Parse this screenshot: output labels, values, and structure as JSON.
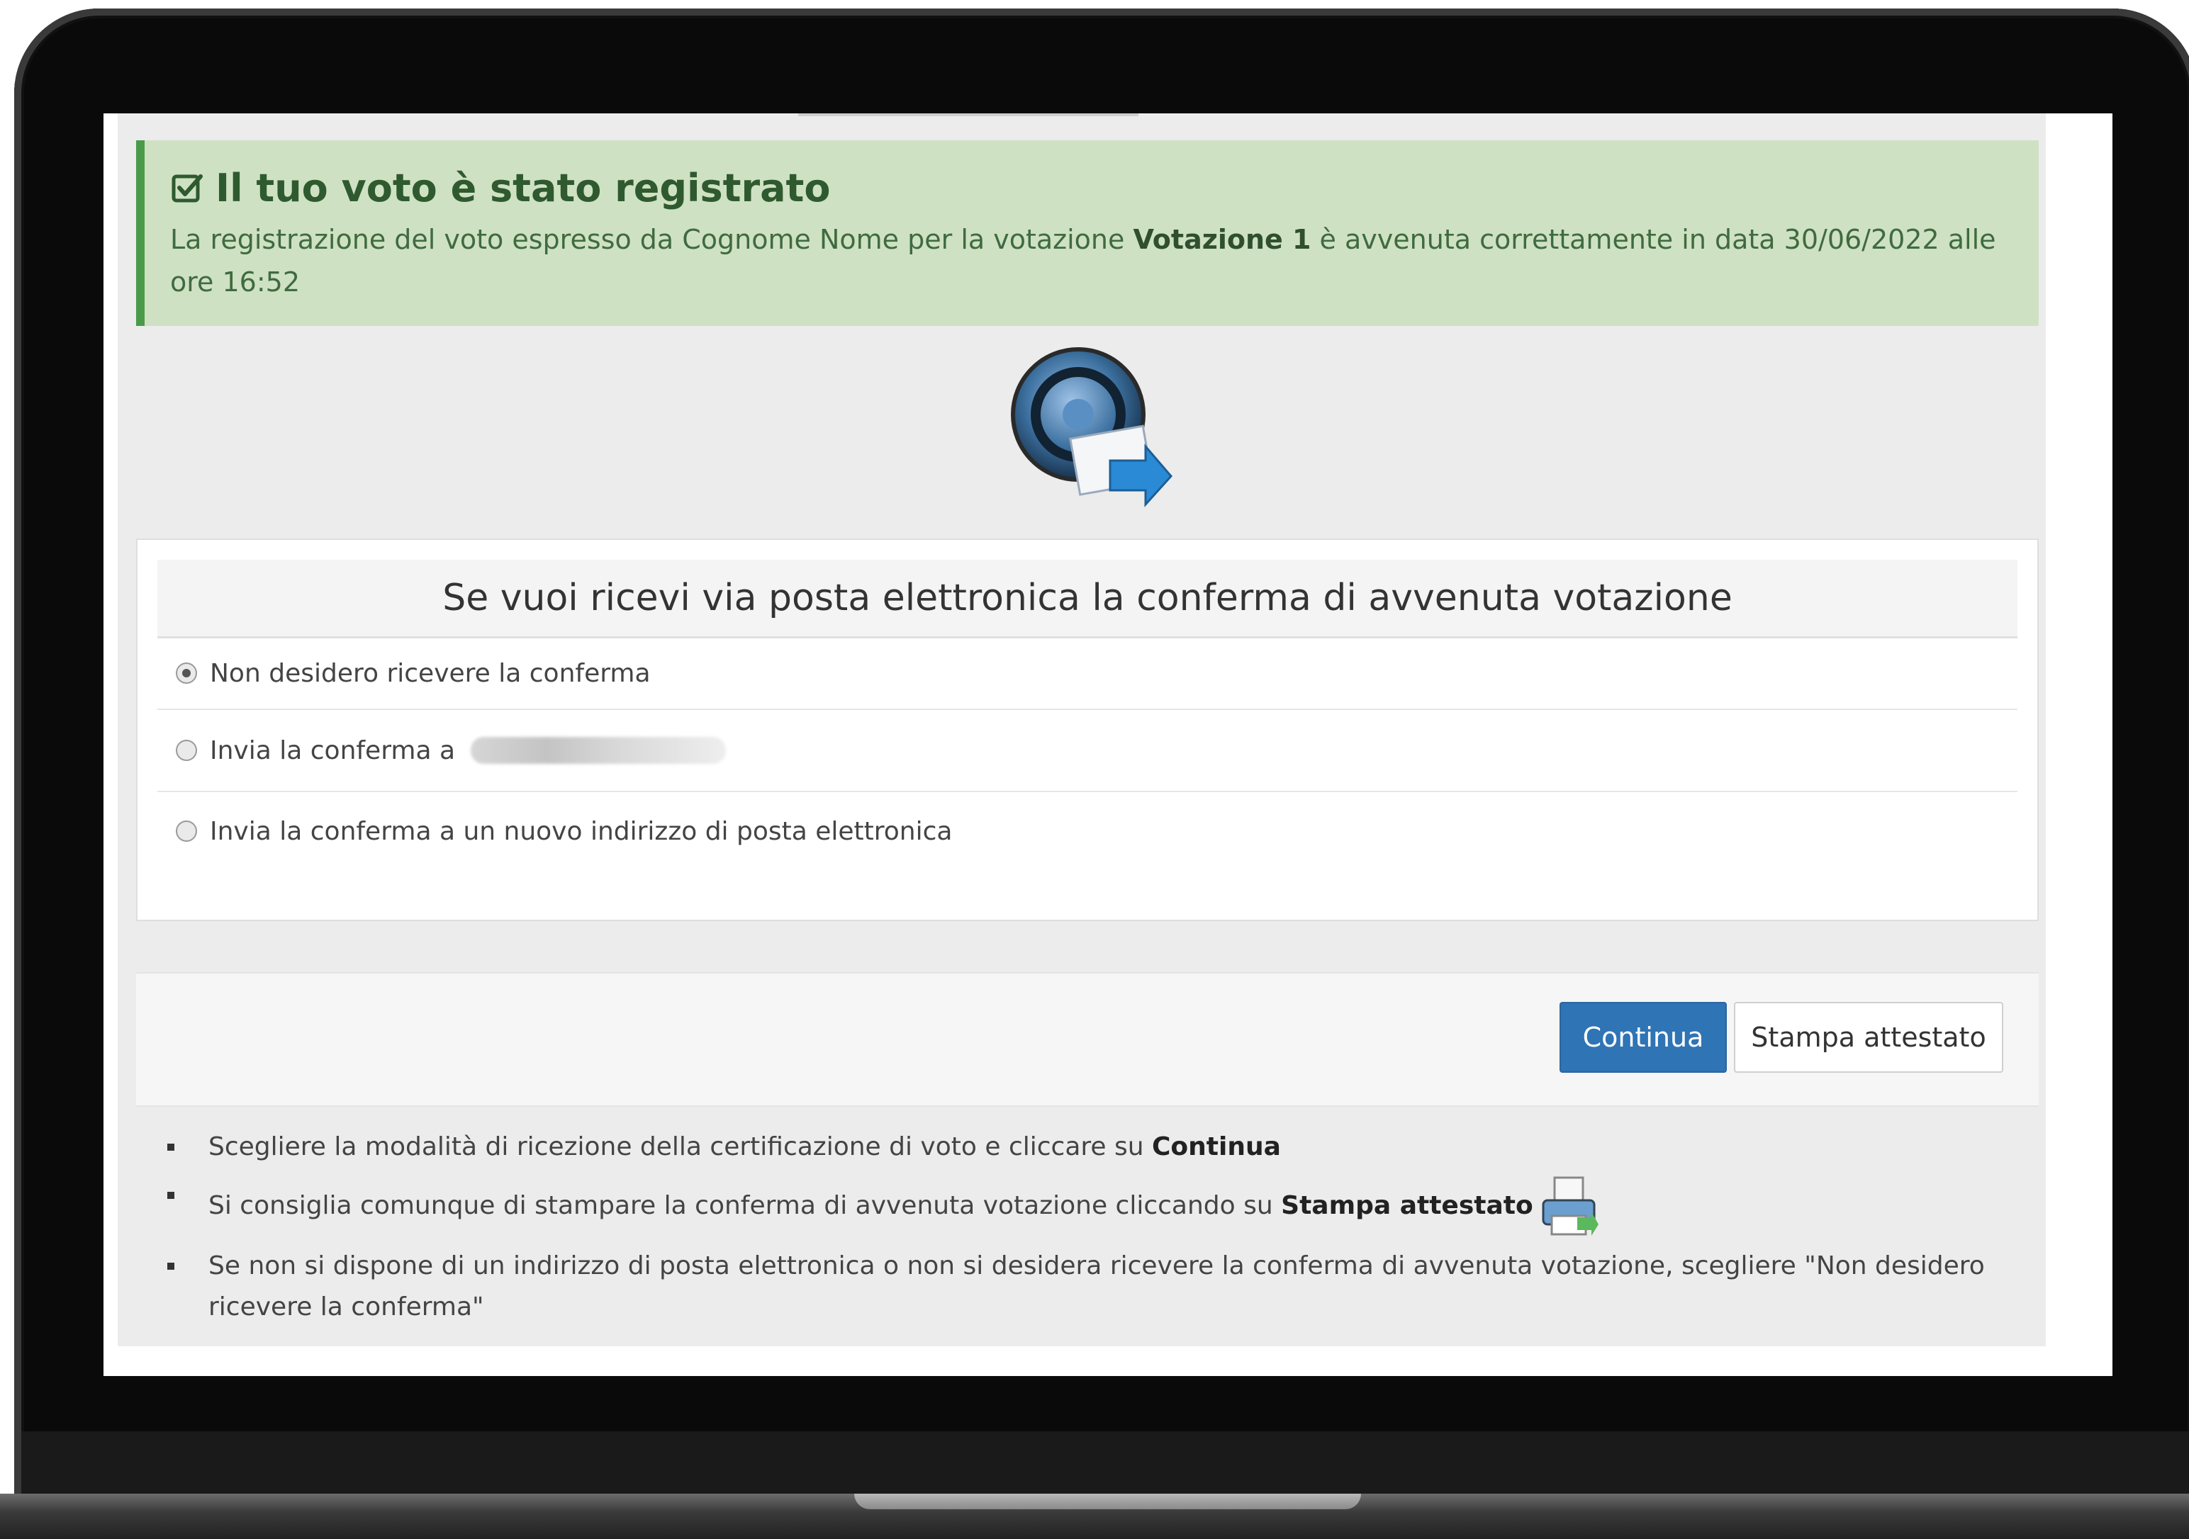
{
  "alert": {
    "title": "Il tuo voto è stato registrato",
    "text_before": "La registrazione del voto espresso da Cognome Nome per la votazione ",
    "votazione": "Votazione 1",
    "text_after": " è avvenuta correttamente in data 30/06/2022 alle ore 16:52",
    "icon": "check-square-icon",
    "color": "#cfe1c3"
  },
  "email_panel": {
    "heading": "Se vuoi ricevi via posta elettronica la conferma di avvenuta votazione",
    "options": [
      {
        "label": "Non desidero ricevere la conferma",
        "selected": true
      },
      {
        "label": "Invia la conferma a",
        "selected": false
      },
      {
        "label": "Invia la conferma a un nuovo indirizzo di posta elettronica",
        "selected": false
      }
    ]
  },
  "buttons": {
    "continue": "Continua",
    "print": "Stampa attestato",
    "primary_color": "#2f74b5"
  },
  "notes": {
    "n1_text": "Scegliere la modalità di ricezione della certificazione di voto e cliccare su ",
    "n1_bold": "Continua",
    "n2_text": "Si consiglia comunque di stampare la conferma di avvenuta votazione cliccando su ",
    "n2_bold": "Stampa attestato",
    "n3_text": "Se non si dispone di un indirizzo di posta elettronica o non si desidera ricevere la conferma di avvenuta votazione, scegliere \"Non desidero ricevere la conferma\""
  }
}
